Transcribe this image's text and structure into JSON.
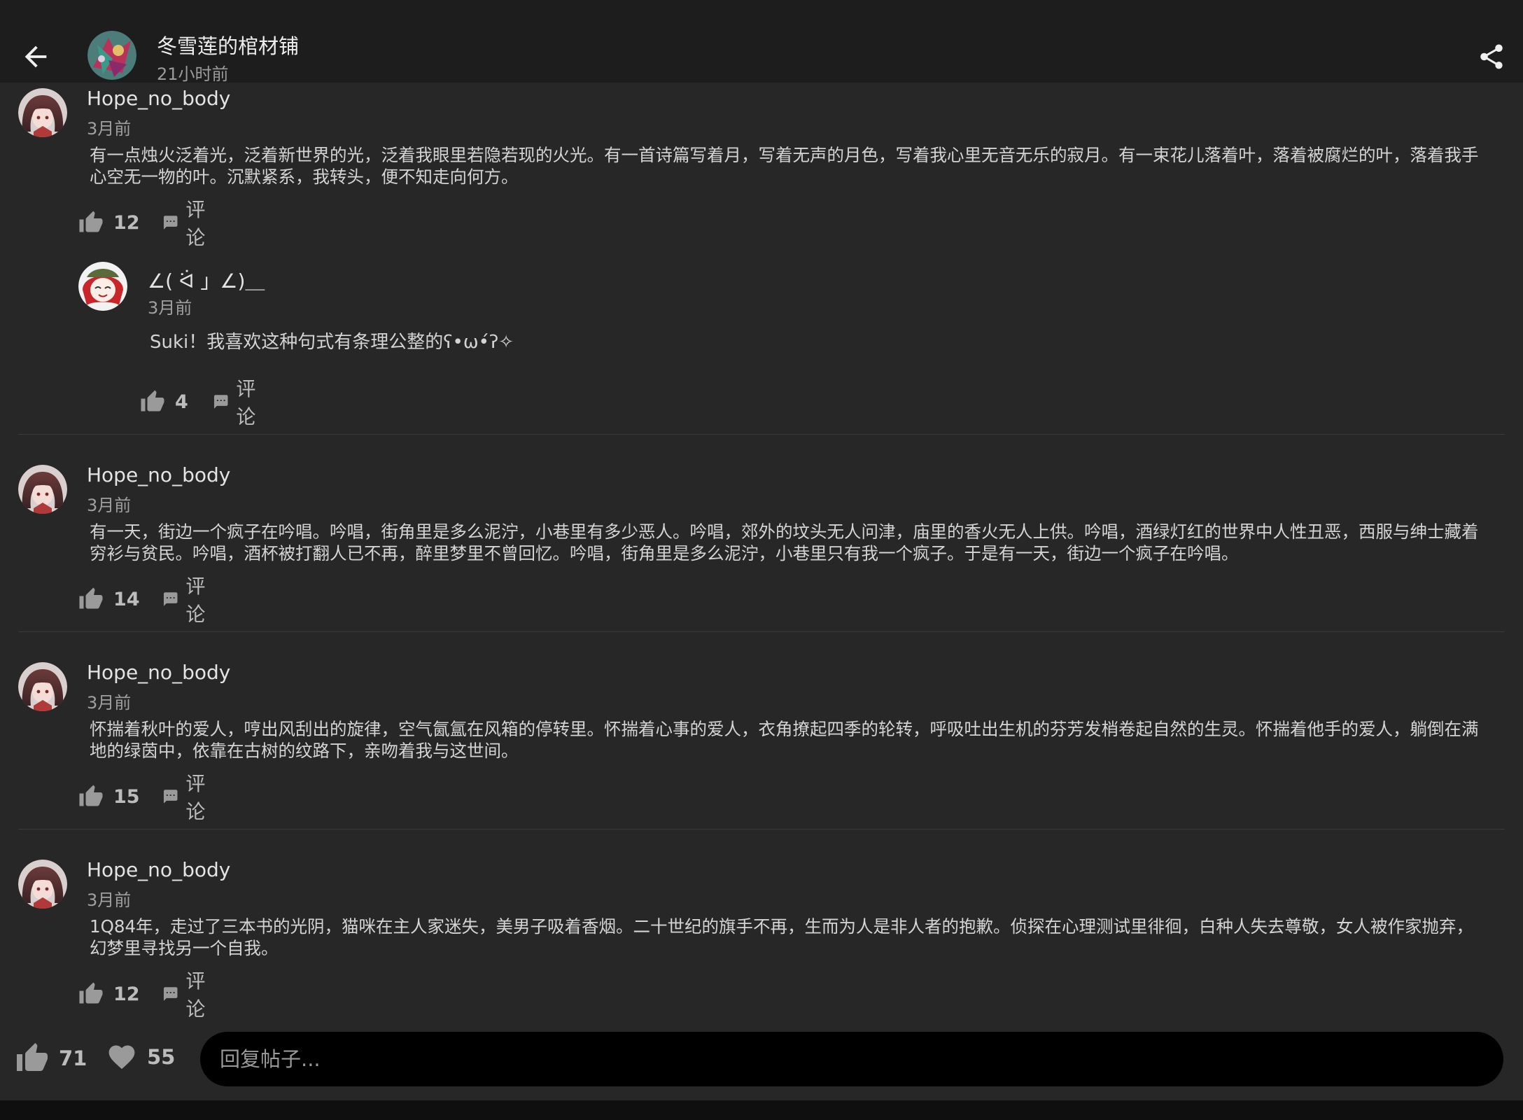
{
  "header": {
    "title": "冬雪莲的棺材铺",
    "time": "21小时前",
    "icons": {
      "back": "arrow-left-icon",
      "share": "share-icon"
    }
  },
  "comments": [
    {
      "author": "Hope_no_body",
      "time": "3月前",
      "text": "有一点烛火泛着光，泛着新世界的光，泛着我眼里若隐若现的火光。有一首诗篇写着月，写着无声的月色，写着我心里无音无乐的寂月。有一束花儿落着叶，落着被腐烂的叶，落着我手心空无一物的叶。沉默紧系，我转头，便不知走向何方。",
      "likes": "12",
      "reply_label": "评论",
      "replies": [
        {
          "author": "∠( ᐛ 」∠)＿",
          "time": "3月前",
          "text": "Suki！我喜欢这种句式有条理公整的ʕ•ω•́ʔ✧",
          "likes": "4",
          "reply_label": "评论"
        }
      ]
    },
    {
      "author": "Hope_no_body",
      "time": "3月前",
      "text": "有一天，街边一个疯子在吟唱。吟唱，街角里是多么泥泞，小巷里有多少恶人。吟唱，郊外的坟头无人问津，庙里的香火无人上供。吟唱，酒绿灯红的世界中人性丑恶，西服与绅士藏着穷衫与贫民。吟唱，酒杯被打翻人已不再，醉里梦里不曾回忆。吟唱，街角里是多么泥泞，小巷里只有我一个疯子。于是有一天，街边一个疯子在吟唱。",
      "likes": "14",
      "reply_label": "评论"
    },
    {
      "author": "Hope_no_body",
      "time": "3月前",
      "text": "怀揣着秋叶的爱人，哼出风刮出的旋律，空气氤氲在风箱的停转里。怀揣着心事的爱人，衣角撩起四季的轮转，呼吸吐出生机的芬芳发梢卷起自然的生灵。怀揣着他手的爱人，躺倒在满地的绿茵中，依靠在古树的纹路下，亲吻着我与这世间。",
      "likes": "15",
      "reply_label": "评论"
    },
    {
      "author": "Hope_no_body",
      "time": "3月前",
      "text": "1Q84年，走过了三本书的光阴，猫咪在主人家迷失，美男子吸着香烟。二十世纪的旗手不再，生而为人是非人者的抱歉。侦探在心理测试里徘徊，白种人失去尊敬，女人被作家抛弃，幻梦里寻找另一个自我。",
      "likes": "12",
      "reply_label": "评论"
    }
  ],
  "bottom_bar": {
    "likes": "71",
    "favorites": "55",
    "reply_placeholder": "回复帖子...",
    "icons": {
      "like": "thumbs-up-icon",
      "favorite": "heart-icon"
    }
  },
  "colors": {
    "background": "#272727",
    "header": "#1d1d1d",
    "input": "#000000",
    "text": "#e6e6e6",
    "muted": "#a0a0a0"
  }
}
